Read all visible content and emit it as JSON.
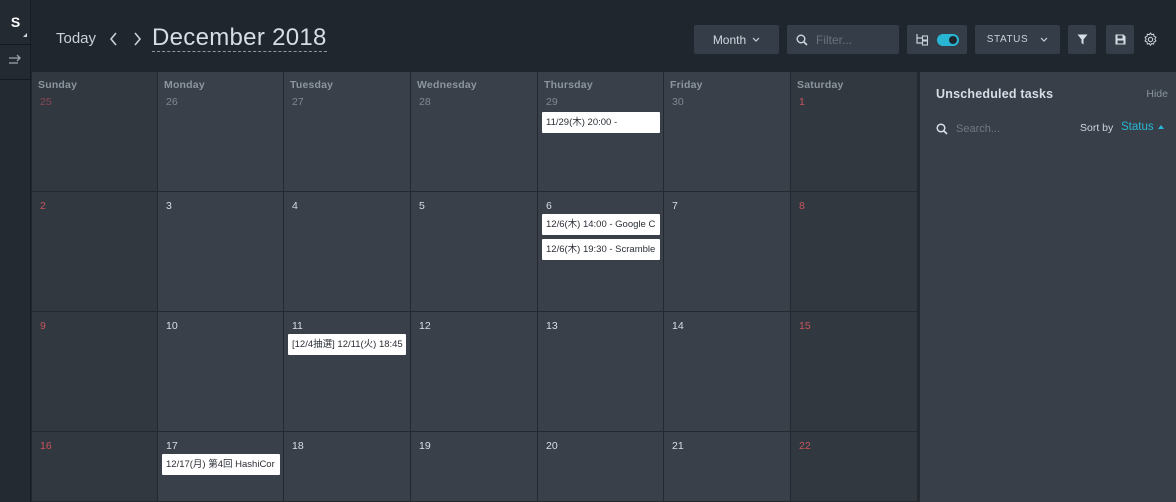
{
  "rail": {
    "workspace_initial": "S"
  },
  "header": {
    "today_label": "Today",
    "month_title": "December 2018",
    "view_select": "Month",
    "filter_placeholder": "Filter...",
    "status_label": "STATUS"
  },
  "colors": {
    "accent": "#29b6d4",
    "weekend_number": "#c9545b",
    "event_bg": "#ffffff",
    "cell_bg": "#394049",
    "weekend_bg": "#313840"
  },
  "calendar": {
    "weekdays": [
      "Sunday",
      "Monday",
      "Tuesday",
      "Wednesday",
      "Thursday",
      "Friday",
      "Saturday"
    ],
    "weeks": [
      {
        "days": [
          {
            "num": "25",
            "events": []
          },
          {
            "num": "26",
            "events": []
          },
          {
            "num": "27",
            "events": []
          },
          {
            "num": "28",
            "events": []
          },
          {
            "num": "29",
            "events": [
              "11/29(木) 20:00 -"
            ]
          },
          {
            "num": "30",
            "events": []
          },
          {
            "num": "1",
            "events": []
          }
        ]
      },
      {
        "days": [
          {
            "num": "2",
            "events": []
          },
          {
            "num": "3",
            "events": []
          },
          {
            "num": "4",
            "events": []
          },
          {
            "num": "5",
            "events": []
          },
          {
            "num": "6",
            "events": [
              "12/6(木) 14:00 - Google C",
              "12/6(木) 19:30 - Scramble"
            ]
          },
          {
            "num": "7",
            "events": []
          },
          {
            "num": "8",
            "events": []
          }
        ]
      },
      {
        "days": [
          {
            "num": "9",
            "events": []
          },
          {
            "num": "10",
            "events": []
          },
          {
            "num": "11",
            "events": [
              "[12/4抽選] 12/11(火) 18:45"
            ]
          },
          {
            "num": "12",
            "events": []
          },
          {
            "num": "13",
            "events": []
          },
          {
            "num": "14",
            "events": []
          },
          {
            "num": "15",
            "events": []
          }
        ]
      },
      {
        "days": [
          {
            "num": "16",
            "events": []
          },
          {
            "num": "17",
            "events": [
              "12/17(月) 第4回 HashiCor"
            ]
          },
          {
            "num": "18",
            "events": []
          },
          {
            "num": "19",
            "events": []
          },
          {
            "num": "20",
            "events": []
          },
          {
            "num": "21",
            "events": []
          },
          {
            "num": "22",
            "events": []
          }
        ]
      }
    ]
  },
  "unscheduled": {
    "title": "Unscheduled tasks",
    "hide_label": "Hide",
    "search_placeholder": "Search...",
    "sort_label": "Sort by",
    "sort_value": "Status"
  }
}
